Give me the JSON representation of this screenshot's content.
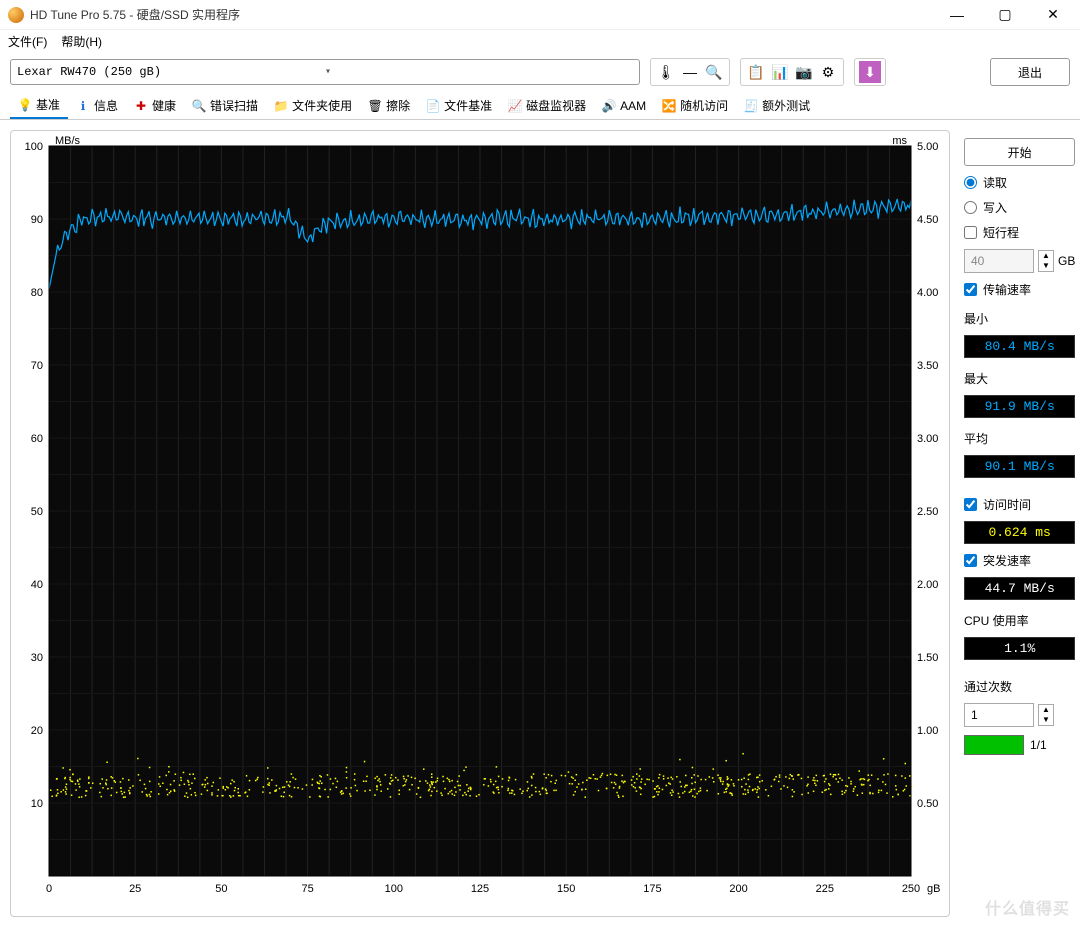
{
  "window": {
    "title": "HD Tune Pro 5.75 - 硬盘/SSD 实用程序"
  },
  "menu": {
    "file": "文件(F)",
    "help": "帮助(H)"
  },
  "drive": {
    "label": "Lexar   RW470 (250 gB)"
  },
  "toolbar": {
    "exit": "退出"
  },
  "tabs": {
    "benchmark": "基准",
    "info": "信息",
    "health": "健康",
    "errorscan": "错误扫描",
    "folderusage": "文件夹使用",
    "erase": "擦除",
    "filebench": "文件基准",
    "diskmon": "磁盘监视器",
    "aam": "AAM",
    "random": "随机访问",
    "extra": "额外测试"
  },
  "controls": {
    "start": "开始",
    "read": "读取",
    "write": "写入",
    "shortstroke": "短行程",
    "shortstroke_val": "40",
    "shortstroke_unit": "GB"
  },
  "stats": {
    "transfer": {
      "label": "传输速率",
      "min_label": "最小",
      "min": "80.4 MB/s",
      "max_label": "最大",
      "max": "91.9 MB/s",
      "avg_label": "平均",
      "avg": "90.1 MB/s"
    },
    "access": {
      "label": "访问时间",
      "value": "0.624 ms"
    },
    "burst": {
      "label": "突发速率",
      "value": "44.7 MB/s"
    },
    "cpu": {
      "label": "CPU 使用率",
      "value": "1.1%"
    },
    "passes": {
      "label": "通过次数",
      "count": "1",
      "progress": "1/1"
    }
  },
  "chart_data": {
    "type": "line",
    "xlabel": "gB",
    "ylabel_left": "MB/s",
    "ylabel_right": "ms",
    "xlim": [
      0,
      250
    ],
    "ylim_left": [
      0,
      100
    ],
    "ylim_right": [
      0,
      5
    ],
    "xticks": [
      0,
      25,
      50,
      75,
      100,
      125,
      150,
      175,
      200,
      225,
      250
    ],
    "yticks_left": [
      10,
      20,
      30,
      40,
      50,
      60,
      70,
      80,
      90,
      100
    ],
    "yticks_right": [
      "0.50",
      "1.00",
      "1.50",
      "2.00",
      "2.50",
      "3.00",
      "3.50",
      "4.00",
      "4.50",
      "5.00"
    ],
    "series": [
      {
        "name": "Transfer Rate (MB/s)",
        "axis": "left",
        "color": "#00aaff",
        "x": [
          0,
          2,
          5,
          10,
          20,
          30,
          40,
          50,
          60,
          70,
          75,
          80,
          90,
          100,
          110,
          120,
          130,
          140,
          150,
          160,
          170,
          180,
          190,
          200,
          210,
          220,
          230,
          240,
          250
        ],
        "y": [
          80.4,
          85,
          88,
          90,
          90.5,
          90,
          90.2,
          90,
          90.1,
          90,
          87,
          89.5,
          90,
          90,
          90,
          89.8,
          90.1,
          89.9,
          90,
          90.2,
          90,
          90.1,
          90.3,
          90.5,
          90.6,
          90.8,
          91,
          91.5,
          91.9
        ]
      },
      {
        "name": "Access Time (ms)",
        "axis": "right",
        "color": "#ffff00",
        "avg": 0.624,
        "spread": 0.08
      }
    ]
  },
  "watermark": "什么值得买"
}
